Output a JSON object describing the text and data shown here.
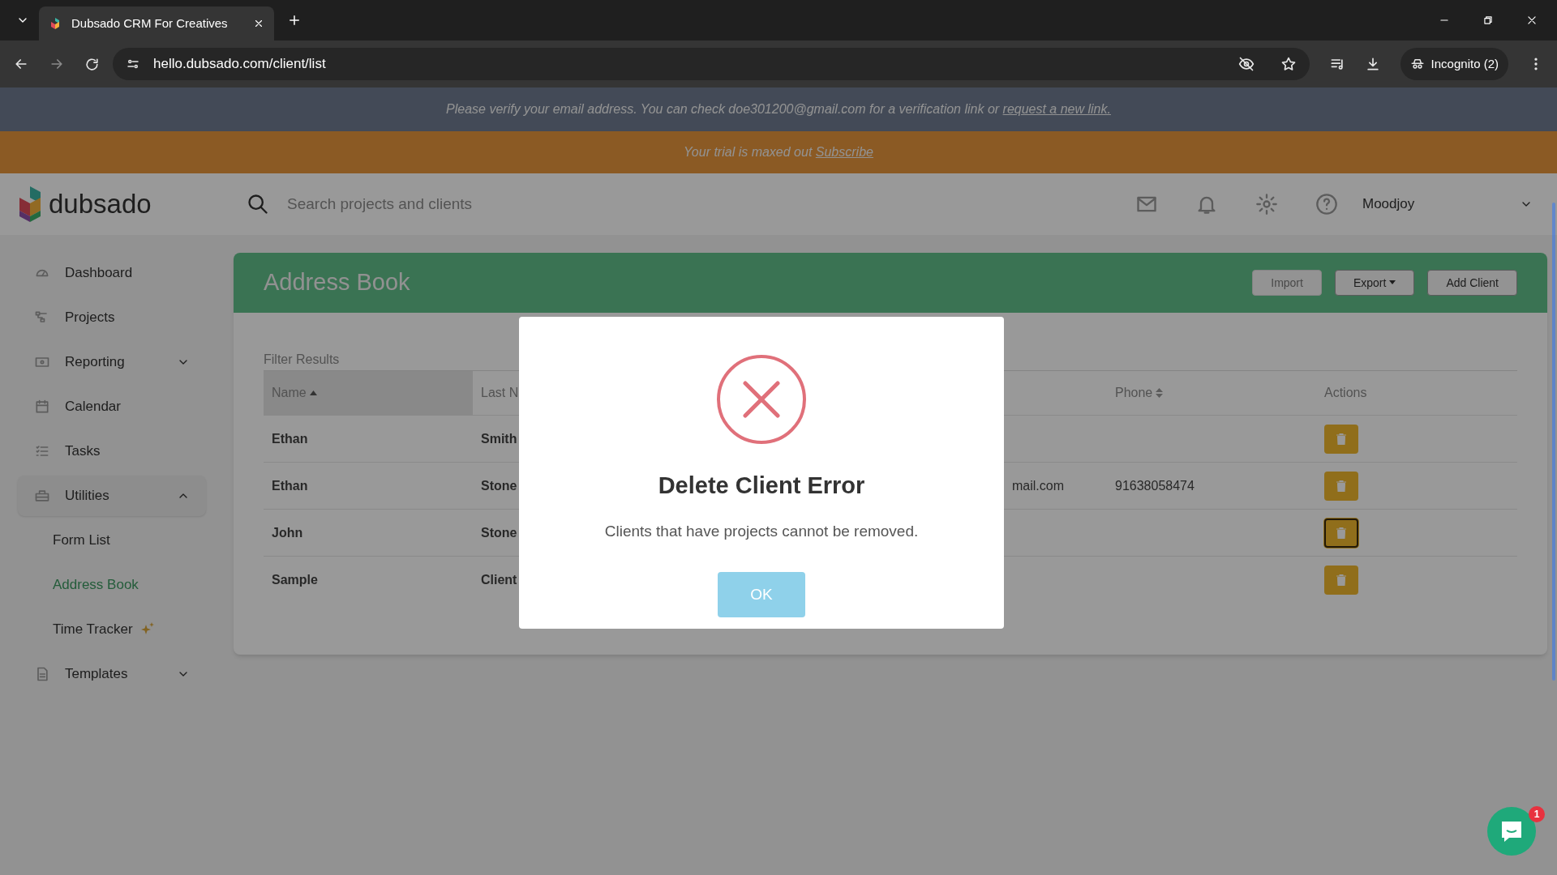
{
  "browser": {
    "tab_title": "Dubsado CRM For Creatives",
    "url": "hello.dubsado.com/client/list",
    "profile": "Incognito (2)"
  },
  "banners": [
    {
      "kind": "verify",
      "text": "Please verify your email address. You can check doe301200@gmail.com for a verification link or",
      "link": "request a new link."
    },
    {
      "kind": "trial",
      "text": "Your trial is maxed out",
      "link": "Subscribe"
    }
  ],
  "header": {
    "logo": "dubsado",
    "search": {
      "placeholder": "Search projects and clients"
    },
    "user": "Moodjoy"
  },
  "sidebar": {
    "items": [
      {
        "label": "Dashboard",
        "selected": false
      },
      {
        "label": "Projects",
        "selected": false
      },
      {
        "label": "Reporting",
        "selected": false,
        "expanded": false
      },
      {
        "label": "Calendar",
        "selected": false
      },
      {
        "label": "Tasks",
        "selected": false
      },
      {
        "label": "Utilities",
        "selected": false,
        "expanded": true,
        "children": [
          {
            "label": "Form List",
            "selected": false,
            "new": false
          },
          {
            "label": "Address Book",
            "selected": true,
            "new": false
          },
          {
            "label": "Time Tracker",
            "selected": false,
            "new": true
          }
        ]
      },
      {
        "label": "Templates",
        "selected": false,
        "expanded": false
      }
    ]
  },
  "page": {
    "title": "Address Book",
    "buttons": [
      {
        "label": "Import",
        "kind": "plain",
        "disabled": true
      },
      {
        "label": "Export",
        "kind": "dropdown",
        "disabled": false
      },
      {
        "label": "Add Client",
        "kind": "plain",
        "disabled": false
      }
    ],
    "filter_label": "Filter Results",
    "table": {
      "columns": [
        {
          "label": "Name",
          "sortable": true,
          "sorted": true
        },
        {
          "label": "Last N"
        },
        {
          "label": "Phone",
          "sortable": true,
          "sorted": false
        },
        {
          "label": "Actions"
        }
      ],
      "rows": [
        {
          "name": "Ethan",
          "last_name": "Smith",
          "focused": false
        },
        {
          "name": "Ethan",
          "last_name": "Stone",
          "email": "mail.com",
          "phone": "91638058474",
          "focused": false
        },
        {
          "name": "John",
          "last_name": "Stone",
          "focused": true
        },
        {
          "name": "Sample",
          "last_name": "Client",
          "focused": false
        }
      ]
    }
  },
  "dialog": {
    "title": "Delete Client Error",
    "message": "Clients that have projects cannot be removed.",
    "button": "OK"
  },
  "chat": {
    "badge": "1"
  }
}
